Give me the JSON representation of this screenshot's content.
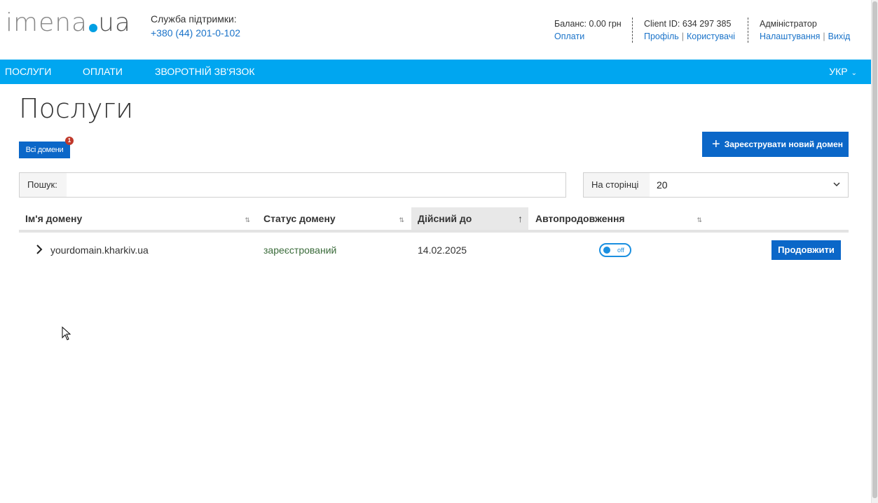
{
  "header": {
    "logo": {
      "main": "imena",
      "tld": "ua"
    },
    "support": {
      "label": "Служба підтримки:",
      "phone": "+380 (44) 201-0-102"
    },
    "balance": {
      "text": "Баланс: 0.00 грн",
      "link": "Оплати"
    },
    "client": {
      "text": "Client ID: 634 297 385",
      "link_profile": "Профіль",
      "link_users": "Користувачі",
      "separator": "|"
    },
    "admin": {
      "text": "Адміністратор",
      "link_settings": "Налаштування",
      "link_logout": "Вихід",
      "separator": "|"
    }
  },
  "nav": {
    "items": [
      "Послуги",
      "Оплати",
      "Зворотній зв'язок"
    ],
    "language": "УКР"
  },
  "page": {
    "title": "Послуги",
    "filter_button": "Всі домени",
    "filter_badge": "1",
    "register_button": "Зареєструвати новий домен"
  },
  "search": {
    "label": "Пошук:",
    "value": "",
    "placeholder": ""
  },
  "per_page": {
    "label": "На сторінці",
    "value": "20"
  },
  "table": {
    "columns": [
      "Ім'я домену",
      "Статус домену",
      "Дійсний до",
      "Автопродовження"
    ],
    "sort_icon": "⇅",
    "active_sort_icon": "↑",
    "rows": [
      {
        "domain": "yourdomain.kharkiv.ua",
        "status": "зареєстрований",
        "valid_until": "14.02.2025",
        "autorenew": "off",
        "action": "Продовжити"
      }
    ]
  },
  "colors": {
    "accent": "#00a6f0",
    "button": "#0b67c8",
    "link": "#1a73c9",
    "badge": "#c0392b"
  }
}
